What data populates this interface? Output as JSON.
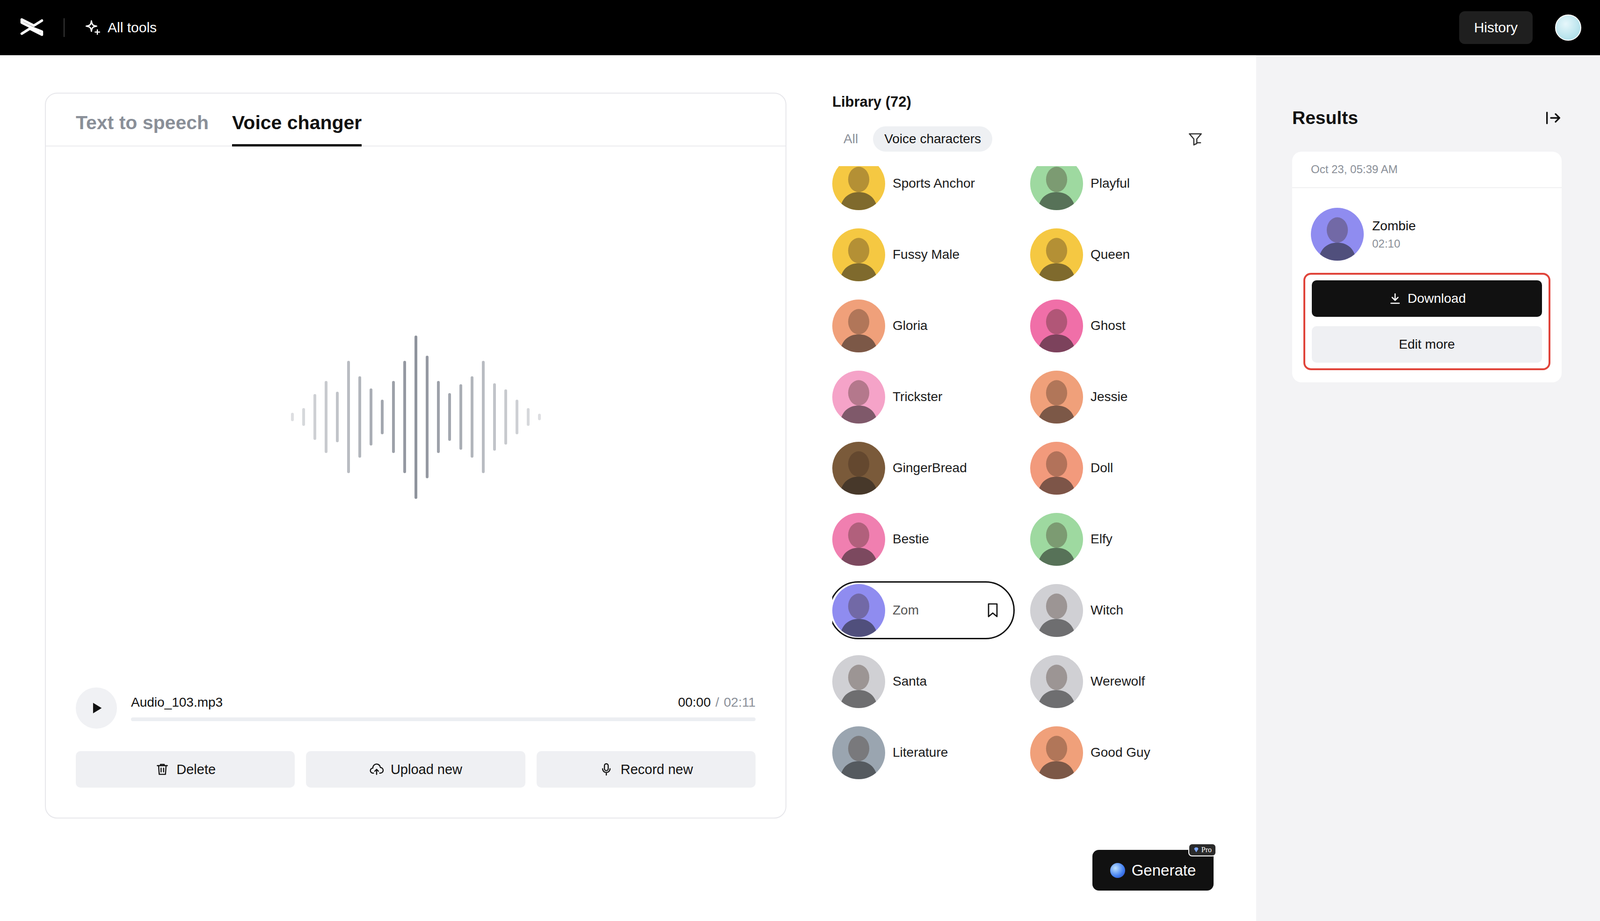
{
  "topbar": {
    "menu": "All tools",
    "history": "History"
  },
  "voice_panel": {
    "tabs": [
      {
        "label": "Text to speech",
        "selected": false
      },
      {
        "label": "Voice changer",
        "selected": true
      }
    ],
    "waveform": [
      0.05,
      0.11,
      0.28,
      0.44,
      0.31,
      0.69,
      0.5,
      0.35,
      0.21,
      0.44,
      0.69,
      1.0,
      0.75,
      0.44,
      0.29,
      0.4,
      0.5,
      0.69,
      0.41,
      0.34,
      0.21,
      0.11,
      0.04
    ],
    "audio": {
      "file": "Audio_103.mp3",
      "current": "00:00",
      "separator": "/",
      "duration": "02:11",
      "level": 0
    },
    "buttons": [
      {
        "label": "Delete",
        "kind": "delete"
      },
      {
        "label": "Upload new",
        "kind": "upload"
      },
      {
        "label": "Record new",
        "kind": "record"
      }
    ]
  },
  "library": {
    "title": "Library (72)",
    "filters": [
      {
        "label": "All",
        "selected": false
      },
      {
        "label": "Voice characters",
        "selected": true
      }
    ],
    "characters": [
      {
        "name": "Sports Anchor",
        "selected": false,
        "color": "#f5c842"
      },
      {
        "name": "Playful",
        "selected": false,
        "color": "#9ed9a0"
      },
      {
        "name": "Fussy Male",
        "selected": false,
        "color": "#f5c842"
      },
      {
        "name": "Queen",
        "selected": false,
        "color": "#f5c842"
      },
      {
        "name": "Gloria",
        "selected": false,
        "color": "#f0a07a"
      },
      {
        "name": "Ghost",
        "selected": false,
        "color": "#f06fa8"
      },
      {
        "name": "Trickster",
        "selected": false,
        "color": "#f5a3c8"
      },
      {
        "name": "Jessie",
        "selected": false,
        "color": "#f0a07a"
      },
      {
        "name": "GingerBread",
        "selected": false,
        "color": "#7a5a3a"
      },
      {
        "name": "Doll",
        "selected": false,
        "color": "#f29a7c"
      },
      {
        "name": "Bestie",
        "selected": false,
        "color": "#f07fb0"
      },
      {
        "name": "Elfy",
        "selected": false,
        "color": "#9ed9a0"
      },
      {
        "name": "Zom",
        "selected": true,
        "color": "#8f8cf0"
      },
      {
        "name": "Witch",
        "selected": false,
        "color": "#d0d0d4"
      },
      {
        "name": "Santa",
        "selected": false,
        "color": "#d0d0d4"
      },
      {
        "name": "Werewolf",
        "selected": false,
        "color": "#d0d0d4"
      },
      {
        "name": "Literature",
        "selected": false,
        "color": "#9aa5b0"
      },
      {
        "name": "Good Guy",
        "selected": false,
        "color": "#f0a07a"
      }
    ],
    "generate": {
      "label": "Generate",
      "badge": "Pro"
    }
  },
  "results": {
    "title": "Results",
    "items": [
      {
        "date": "Oct 23, 05:39 AM",
        "voice": "Zombie",
        "duration": "02:10",
        "color": "#8f8cf0",
        "highlighted": true,
        "actions": [
          "Download",
          "Edit more"
        ]
      }
    ]
  }
}
